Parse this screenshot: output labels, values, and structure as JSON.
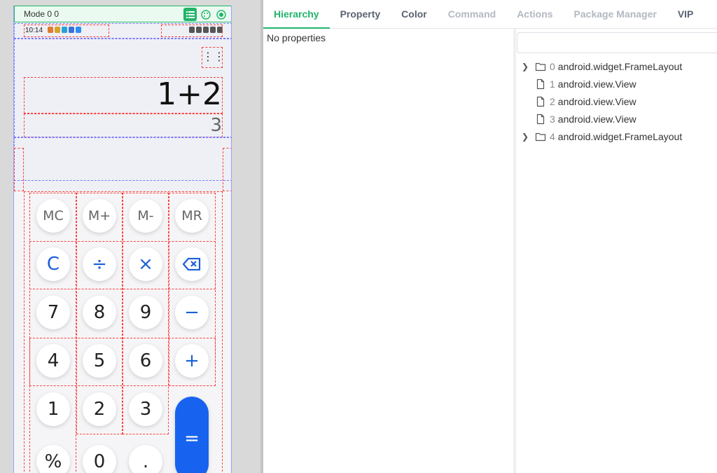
{
  "phone": {
    "mode_label": "Mode 0 0",
    "status_time": "10:14"
  },
  "calculator": {
    "menu_icon": "menu-dots-icon",
    "expression": "1+2",
    "result": "3",
    "keys": {
      "mc": "MC",
      "mplus": "M+",
      "mminus": "M-",
      "mr": "MR",
      "clear": "C",
      "divide": "÷",
      "multiply": "×",
      "backspace": "⌫",
      "seven": "7",
      "eight": "8",
      "nine": "9",
      "minus": "−",
      "four": "4",
      "five": "5",
      "six": "6",
      "plus": "+",
      "one": "1",
      "two": "2",
      "three": "3",
      "equals": "=",
      "percent": "%",
      "zero": "0",
      "dot": "."
    },
    "colors": {
      "accent": "#1763f0",
      "operator": "#1a5fd6"
    }
  },
  "inspector": {
    "tabs": [
      {
        "label": "Hierarchy",
        "state": "active"
      },
      {
        "label": "Property",
        "state": "normal"
      },
      {
        "label": "Color",
        "state": "normal"
      },
      {
        "label": "Command",
        "state": "disabled"
      },
      {
        "label": "Actions",
        "state": "disabled"
      },
      {
        "label": "Package Manager",
        "state": "disabled"
      },
      {
        "label": "VIP",
        "state": "normal"
      }
    ],
    "properties_empty": "No properties",
    "tree": [
      {
        "index": "0",
        "name": "android.widget.FrameLayout",
        "type": "folder",
        "expandable": true
      },
      {
        "index": "1",
        "name": "android.view.View",
        "type": "file",
        "expandable": false
      },
      {
        "index": "2",
        "name": "android.view.View",
        "type": "file",
        "expandable": false
      },
      {
        "index": "3",
        "name": "android.view.View",
        "type": "file",
        "expandable": false
      },
      {
        "index": "4",
        "name": "android.widget.FrameLayout",
        "type": "folder",
        "expandable": true
      }
    ],
    "colors": {
      "accent": "#21b46a"
    }
  }
}
